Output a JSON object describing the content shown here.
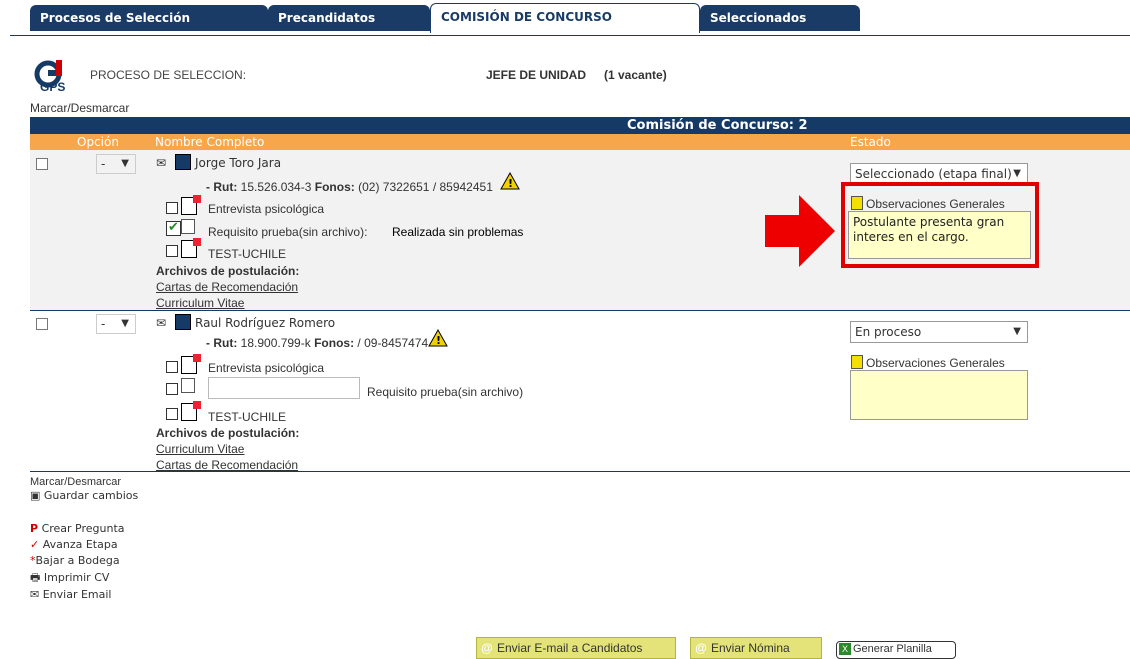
{
  "tabs": [
    {
      "label": "Procesos de Selección"
    },
    {
      "label": "Precandidatos"
    },
    {
      "label": "COMISIÓN DE CONCURSO"
    },
    {
      "label": "Seleccionados"
    }
  ],
  "header": {
    "logo_text": "GPS",
    "process_label": "PROCESO DE SELECCION:",
    "job_title": "JEFE DE UNIDAD",
    "vacancies": "(1 vacante)"
  },
  "toggle_top": "Marcar/Desmarcar",
  "table": {
    "title": "Comisión de Concurso: 2",
    "col_option": "Opción",
    "col_name": "Nombre Completo",
    "col_state": "Estado"
  },
  "candidates": [
    {
      "option": "-",
      "name": "Jorge Toro Jara",
      "rut_label": "- Rut:",
      "rut": "15.526.034-3",
      "phones_label": "Fonos:",
      "phones": "(02) 7322651 / 85942451",
      "task1": "Entrevista psicológica",
      "task2": "Requisito prueba(sin archivo):",
      "task2_result": "Realizada sin problemas",
      "task3": "TEST-UCHILE",
      "files_label": "Archivos de postulación:",
      "files": [
        "Cartas de Recomendación",
        "Curriculum Vitae"
      ],
      "state": "Seleccionado (etapa final)",
      "obs_label": "Observaciones Generales",
      "obs_text": "Postulante presenta gran interes en el cargo."
    },
    {
      "option": "-",
      "name": "Raul Rodríguez Romero",
      "rut_label": "- Rut:",
      "rut": "18.900.799-k",
      "phones_label": "Fonos:",
      "phones": "/ 09-8457474",
      "task1": "Entrevista psicológica",
      "task2": "Requisito prueba(sin archivo)",
      "task3": "TEST-UCHILE",
      "files_label": "Archivos de postulación:",
      "files": [
        "Curriculum Vitae",
        "Cartas de Recomendación"
      ],
      "state": "En proceso",
      "obs_label": "Observaciones Generales",
      "obs_text": ""
    }
  ],
  "toggle_bottom": "Marcar/Desmarcar",
  "save": "Guardar cambios",
  "legend": [
    {
      "symbol": "P",
      "label": "Crear Pregunta"
    },
    {
      "symbol": "✓",
      "label": "Avanza Etapa"
    },
    {
      "symbol": "*",
      "label": "Bajar a Bodega"
    },
    {
      "symbol": "🖶",
      "label": "Imprimir CV"
    },
    {
      "symbol": "✉",
      "label": "Enviar Email"
    }
  ],
  "buttons": {
    "email": "Enviar E-mail a Candidatos",
    "nomina": "Enviar Nómina",
    "planilla": "Generar Planilla"
  },
  "colors": {
    "navy": "#163a66",
    "orange": "#f7a64b",
    "highlight": "#e00000",
    "note": "#ffffc8"
  }
}
